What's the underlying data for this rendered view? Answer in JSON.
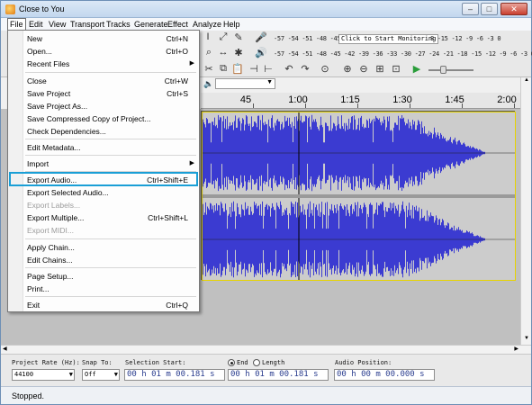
{
  "window": {
    "title": "Close to You"
  },
  "titlebar_buttons": {
    "minimize": "–",
    "maximize": "□",
    "close": "✕"
  },
  "menubar": [
    "File",
    "Edit",
    "View",
    "Transport",
    "Tracks",
    "Generate",
    "Effect",
    "Analyze",
    "Help"
  ],
  "meter": {
    "scale_top": "-57 -54 -51 -48 -45 -42",
    "monitor_label": "Click to Start Monitoring",
    "scale_top_right": "8 -15 -12 -9 -6 -3 0",
    "scale_bottom": "-57 -54 -51 -48 -45 -42 -39 -36 -33 -30 -27 -24 -21 -18 -15 -12 -9 -6 -3 0"
  },
  "timeline": {
    "labels": [
      "45",
      "1:00",
      "1:15",
      "1:30",
      "1:45",
      "2:00"
    ]
  },
  "file_menu": [
    {
      "label": "New",
      "shortcut": "Ctrl+N"
    },
    {
      "label": "Open...",
      "shortcut": "Ctrl+O"
    },
    {
      "label": "Recent Files",
      "submenu": true
    },
    {
      "sep": true
    },
    {
      "label": "Close",
      "shortcut": "Ctrl+W"
    },
    {
      "label": "Save Project",
      "shortcut": "Ctrl+S"
    },
    {
      "label": "Save Project As..."
    },
    {
      "label": "Save Compressed Copy of Project..."
    },
    {
      "label": "Check Dependencies..."
    },
    {
      "sep": true
    },
    {
      "label": "Edit Metadata..."
    },
    {
      "sep": true
    },
    {
      "label": "Import",
      "submenu": true
    },
    {
      "sep": true
    },
    {
      "label": "Export Audio...",
      "shortcut": "Ctrl+Shift+E",
      "highlighted": true
    },
    {
      "label": "Export Selected Audio..."
    },
    {
      "label": "Export Labels...",
      "disabled": true
    },
    {
      "label": "Export Multiple...",
      "shortcut": "Ctrl+Shift+L"
    },
    {
      "label": "Export MIDI...",
      "disabled": true
    },
    {
      "sep": true
    },
    {
      "label": "Apply Chain..."
    },
    {
      "label": "Edit Chains..."
    },
    {
      "sep": true
    },
    {
      "label": "Page Setup..."
    },
    {
      "label": "Print..."
    },
    {
      "sep": true
    },
    {
      "label": "Exit",
      "shortcut": "Ctrl+Q"
    }
  ],
  "selection_bar": {
    "project_rate_label": "Project Rate (Hz):",
    "project_rate_value": "44100",
    "snap_label": "Snap To:",
    "snap_value": "Off",
    "selection_start_label": "Selection Start:",
    "selection_start_value": "00 h 01 m 00.181 s",
    "end_label": "End",
    "length_label": "Length",
    "selection_end_value": "00 h 01 m 00.181 s",
    "audio_position_label": "Audio Position:",
    "audio_position_value": "00 h 00 m 00.000 s"
  },
  "status": {
    "text": "Stopped."
  },
  "colors": {
    "waveform": "#3b3bd1",
    "waveform_dark": "#2a2aa8",
    "track_bg": "#c9c9c9",
    "selection_outline": "#e6d300",
    "highlight": "#1a9fd6"
  }
}
